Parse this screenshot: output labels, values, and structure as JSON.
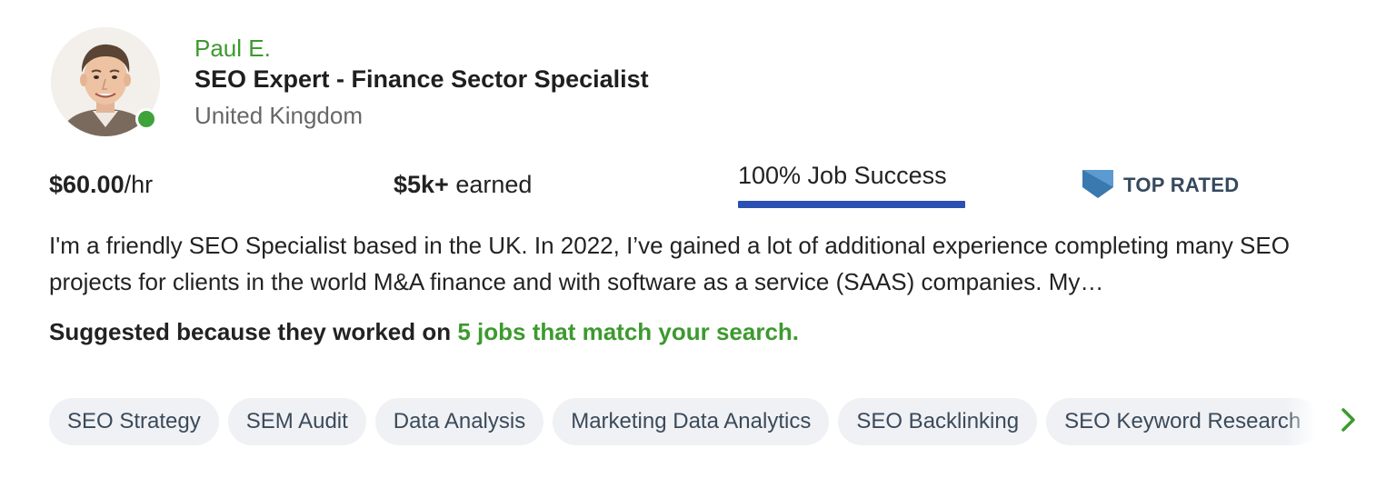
{
  "freelancer": {
    "name": "Paul E.",
    "title": "SEO Expert - Finance Sector Specialist",
    "location": "United Kingdom",
    "online": true
  },
  "stats": {
    "rate_amount": "$60.00",
    "rate_unit": "/hr",
    "earned_amount": "$5k+",
    "earned_label": " earned",
    "job_success": "100% Job Success",
    "job_success_fraction": 1.0,
    "badge": "TOP RATED"
  },
  "description": "I'm a friendly SEO Specialist based in the UK. In 2022, I’ve gained a lot of additional experience completing many SEO projects for clients in the world M&A finance and with software as a service (SAAS) companies. My…",
  "suggested": {
    "prefix": "Suggested because they worked on ",
    "link": "5 jobs that match your search."
  },
  "skills": [
    "SEO Strategy",
    "SEM Audit",
    "Data Analysis",
    "Marketing Data Analytics",
    "SEO Backlinking",
    "SEO Keyword Research"
  ],
  "colors": {
    "accent_green": "#3c9a2e",
    "online_dot": "#3fa33a",
    "job_success_bar": "#2b4fb3",
    "badge_blue": "#3a78b0",
    "chip_bg": "#eff1f4"
  },
  "icons": {
    "badge": "top-rated-badge-icon",
    "next": "chevron-right-icon"
  }
}
